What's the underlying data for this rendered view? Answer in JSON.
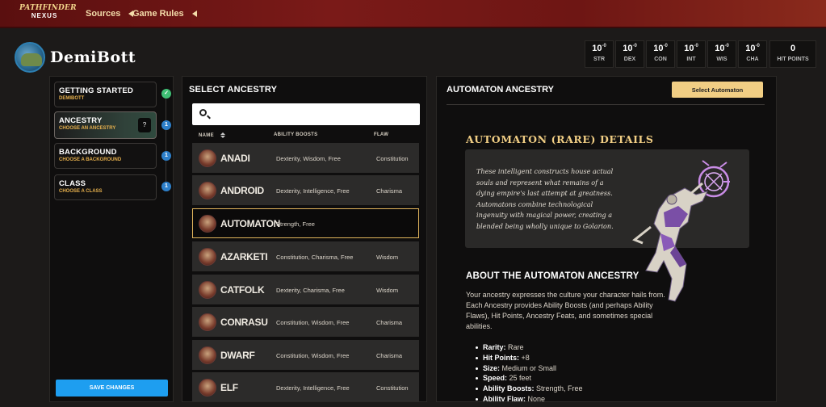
{
  "topnav": {
    "logo_line1": "PATHFINDER",
    "logo_line2": "NEXUS",
    "links": [
      {
        "label": "Sources"
      },
      {
        "label": "Game Rules"
      }
    ]
  },
  "header": {
    "character_name": "DemiBott",
    "stats": [
      {
        "value": "10",
        "mod": "-0",
        "label": "STR"
      },
      {
        "value": "10",
        "mod": "-0",
        "label": "DEX"
      },
      {
        "value": "10",
        "mod": "-0",
        "label": "CON"
      },
      {
        "value": "10",
        "mod": "-0",
        "label": "INT"
      },
      {
        "value": "10",
        "mod": "-0",
        "label": "WIS"
      },
      {
        "value": "10",
        "mod": "-0",
        "label": "CHA"
      }
    ],
    "hit_points": {
      "value": "0",
      "label": "HIT POINTS"
    }
  },
  "steps": [
    {
      "title": "GETTING STARTED",
      "subtitle": "DEMIBOTT",
      "badge": "✓"
    },
    {
      "title": "ANCESTRY",
      "subtitle": "CHOOSE AN ANCESTRY",
      "badge": "1",
      "thumb": "?"
    },
    {
      "title": "BACKGROUND",
      "subtitle": "CHOOSE A BACKGROUND",
      "badge": "1"
    },
    {
      "title": "CLASS",
      "subtitle": "CHOOSE A CLASS",
      "badge": "1"
    }
  ],
  "save_label": "SAVE CHANGES",
  "ancestry_list": {
    "title": "SELECT ANCESTRY",
    "search_value": "",
    "columns": {
      "name": "NAME",
      "boosts": "ABILITY BOOSTS",
      "flaw": "FLAW"
    },
    "rows": [
      {
        "name": "ANADI",
        "boosts": "Dexterity, Wisdom, Free",
        "flaw": "Constitution"
      },
      {
        "name": "ANDROID",
        "boosts": "Dexterity, Intelligence, Free",
        "flaw": "Charisma"
      },
      {
        "name": "AUTOMATON",
        "boosts": "Strength, Free",
        "flaw": ""
      },
      {
        "name": "AZARKETI",
        "boosts": "Constitution, Charisma, Free",
        "flaw": "Wisdom"
      },
      {
        "name": "CATFOLK",
        "boosts": "Dexterity, Charisma, Free",
        "flaw": "Wisdom"
      },
      {
        "name": "CONRASU",
        "boosts": "Constitution, Wisdom, Free",
        "flaw": "Charisma"
      },
      {
        "name": "DWARF",
        "boosts": "Constitution, Wisdom, Free",
        "flaw": "Charisma"
      },
      {
        "name": "ELF",
        "boosts": "Dexterity, Intelligence, Free",
        "flaw": "Constitution"
      }
    ],
    "selected_index": 2
  },
  "detail": {
    "title": "AUTOMATON ANCESTRY",
    "select_label": "Select Automaton",
    "details_title": "AUTOMATON (RARE) DETAILS",
    "quote": "These intelligent constructs house actual souls and represent what remains of a dying empire's last attempt at greatness. Automatons combine technological ingenuity with magical power, creating a blended being wholly unique to Golarion.",
    "about_title": "ABOUT THE AUTOMATON ANCESTRY",
    "about_text": "Your ancestry expresses the culture your character hails from. Each Ancestry provides Ability Boosts (and perhaps Ability Flaws), Hit Points, Ancestry Feats, and sometimes special abilities.",
    "props": [
      {
        "key": "Rarity:",
        "value": "Rare"
      },
      {
        "key": "Hit Points:",
        "value": "+8"
      },
      {
        "key": "Size:",
        "value": "Medium or Small"
      },
      {
        "key": "Speed:",
        "value": "25 feet"
      },
      {
        "key": "Ability Boosts:",
        "value": "Strength, Free"
      },
      {
        "key": "Ability Flaw:",
        "value": "None"
      }
    ]
  },
  "colors": {
    "accent_gold": "#f1ce84",
    "save_blue": "#1e9ef0",
    "badge_blue": "#2d7fc9",
    "badge_green": "#3fbf74",
    "nav_red": "#7a1a18"
  }
}
